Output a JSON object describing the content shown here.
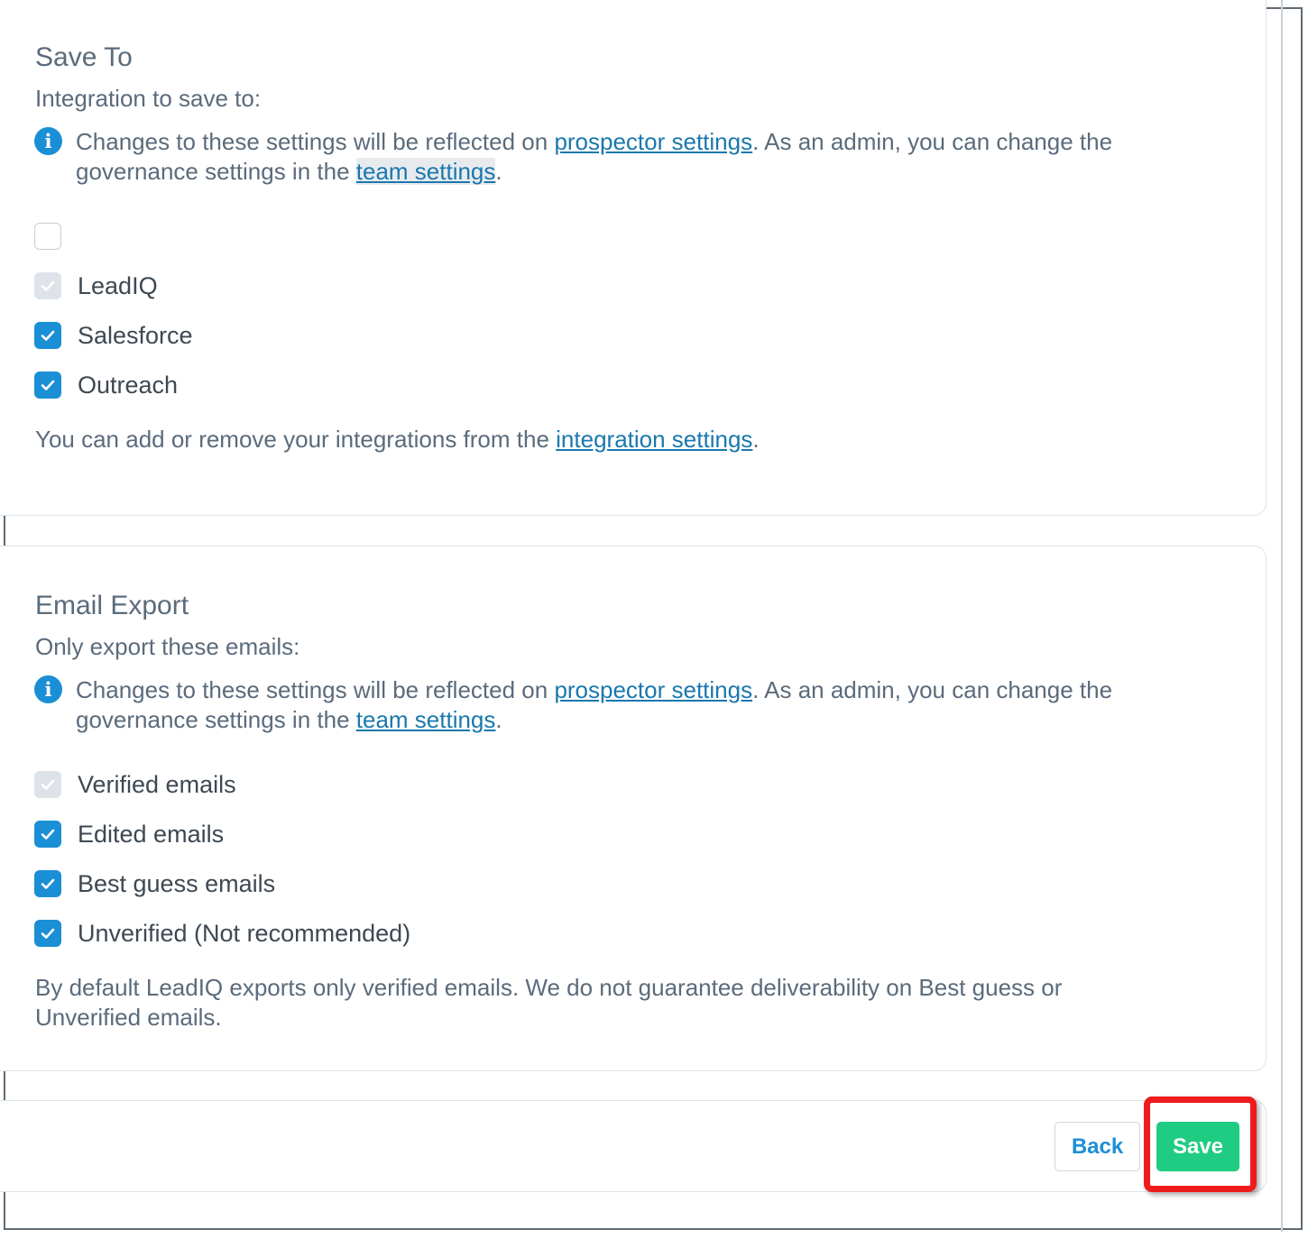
{
  "save_to": {
    "title": "Save To",
    "subtitle": "Integration to save to:",
    "info": {
      "prefix": "Changes to these settings will be reflected on ",
      "link1": "prospector settings",
      "middle": ". As an admin, you can change the governance settings in the ",
      "link2": "team settings",
      "suffix": "."
    },
    "options": [
      {
        "label": "",
        "state": "unchecked"
      },
      {
        "label": "LeadIQ",
        "state": "checked-disabled"
      },
      {
        "label": "Salesforce",
        "state": "checked"
      },
      {
        "label": "Outreach",
        "state": "checked"
      }
    ],
    "note": {
      "prefix": "You can add or remove your integrations from the ",
      "link": "integration settings",
      "suffix": "."
    }
  },
  "email_export": {
    "title": "Email Export",
    "subtitle": "Only export these emails:",
    "info": {
      "prefix": "Changes to these settings will be reflected on ",
      "link1": "prospector settings",
      "middle": ". As an admin, you can change the governance settings in the ",
      "link2": "team settings",
      "suffix": "."
    },
    "options": [
      {
        "label": "Verified emails",
        "state": "checked-disabled"
      },
      {
        "label": "Edited emails",
        "state": "checked"
      },
      {
        "label": "Best guess emails",
        "state": "checked"
      },
      {
        "label": "Unverified (Not recommended)",
        "state": "checked"
      }
    ],
    "note": "By default LeadIQ exports only verified emails. We do not guarantee deliverability on Best guess or Unverified emails."
  },
  "footer": {
    "back_label": "Back",
    "save_label": "Save"
  },
  "colors": {
    "accent": "#1b8fd6",
    "save": "#20cc82",
    "highlight": "#ee1c1c",
    "link": "#1a78ae"
  }
}
